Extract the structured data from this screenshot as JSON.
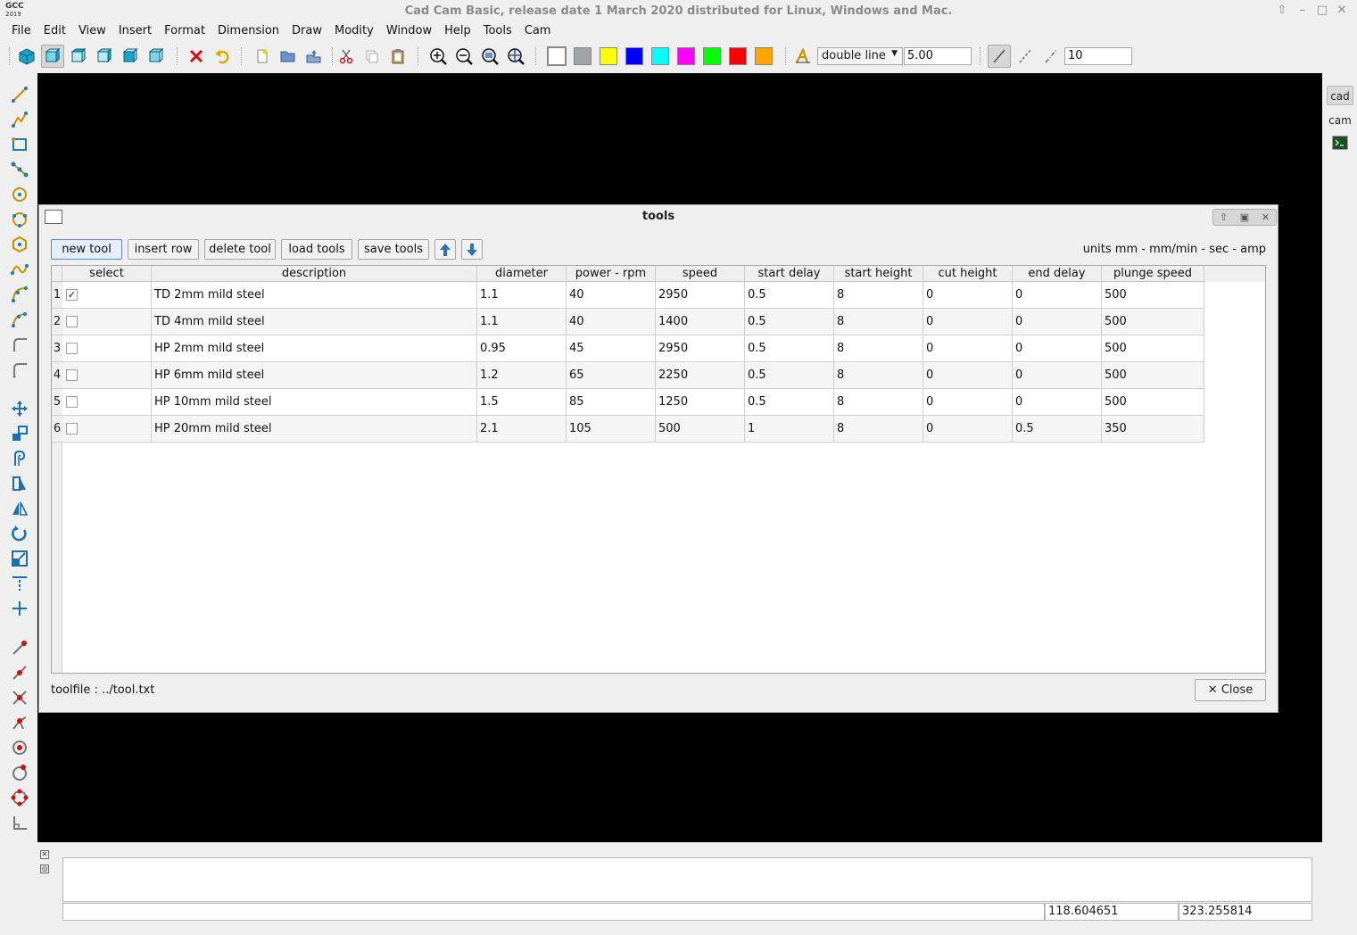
{
  "window": {
    "logo_top": "GCC",
    "logo_bottom": "2019",
    "title": "Cad Cam Basic, release date 1 March 2020 distributed for Linux, Windows and Mac."
  },
  "menu": [
    "File",
    "Edit",
    "View",
    "Insert",
    "Format",
    "Dimension",
    "Draw",
    "Modity",
    "Window",
    "Help",
    "Tools",
    "Cam"
  ],
  "toolbar": {
    "colors": [
      "#ffffff",
      "#a0a4a6",
      "#ffff00",
      "#0000ff",
      "#00ffff",
      "#ff00ff",
      "#00ff00",
      "#ff0000",
      "#ffa500"
    ],
    "line_type": "double line",
    "line_width": "5.00",
    "snap_value": "10"
  },
  "right_panel": {
    "cad_label": "cad",
    "cam_label": "cam"
  },
  "dialog": {
    "title": "tools",
    "buttons": {
      "new_tool": "new tool",
      "insert_row": "insert row",
      "delete_tool": "delete tool",
      "load_tools": "load tools",
      "save_tools": "save tools"
    },
    "units": "units mm - mm/min - sec - amp",
    "columns": [
      "select",
      "description",
      "diameter",
      "power - rpm",
      "speed",
      "start delay",
      "start height",
      "cut height",
      "end delay",
      "plunge speed"
    ],
    "rows": [
      {
        "num": "1",
        "selected": true,
        "description": "TD 2mm mild steel",
        "diameter": "1.1",
        "power": "40",
        "speed": "2950",
        "start_delay": "0.5",
        "start_height": "8",
        "cut_height": "0",
        "end_delay": "0",
        "plunge_speed": "500"
      },
      {
        "num": "2",
        "selected": false,
        "description": "TD 4mm mild steel",
        "diameter": "1.1",
        "power": "40",
        "speed": "1400",
        "start_delay": "0.5",
        "start_height": "8",
        "cut_height": "0",
        "end_delay": "0",
        "plunge_speed": "500"
      },
      {
        "num": "3",
        "selected": false,
        "description": "HP 2mm mild steel",
        "diameter": "0.95",
        "power": "45",
        "speed": "2950",
        "start_delay": "0.5",
        "start_height": "8",
        "cut_height": "0",
        "end_delay": "0",
        "plunge_speed": "500"
      },
      {
        "num": "4",
        "selected": false,
        "description": "HP 6mm mild steel",
        "diameter": "1.2",
        "power": "65",
        "speed": "2250",
        "start_delay": "0.5",
        "start_height": "8",
        "cut_height": "0",
        "end_delay": "0",
        "plunge_speed": "500"
      },
      {
        "num": "5",
        "selected": false,
        "description": "HP 10mm mild steel",
        "diameter": "1.5",
        "power": "85",
        "speed": "1250",
        "start_delay": "0.5",
        "start_height": "8",
        "cut_height": "0",
        "end_delay": "0",
        "plunge_speed": "500"
      },
      {
        "num": "6",
        "selected": false,
        "description": "HP 20mm mild steel",
        "diameter": "2.1",
        "power": "105",
        "speed": "500",
        "start_delay": "1",
        "start_height": "8",
        "cut_height": "0",
        "end_delay": "0.5",
        "plunge_speed": "350"
      }
    ],
    "toolfile": "toolfile : ../tool.txt",
    "close_label": "Close"
  },
  "status": {
    "coord_x": "118.604651",
    "coord_y": "323.255814"
  }
}
